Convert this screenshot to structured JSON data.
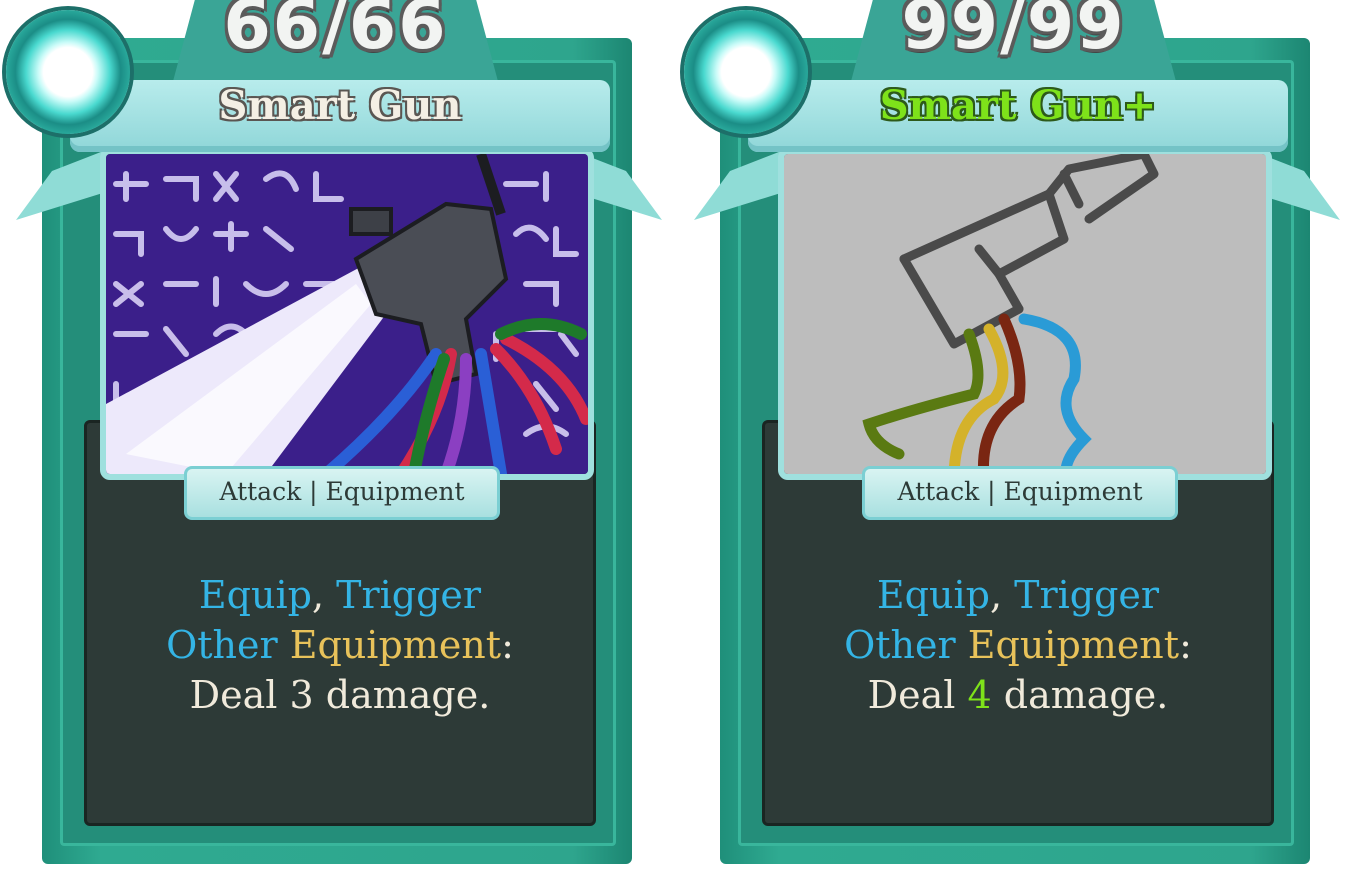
{
  "cards": [
    {
      "counter": "66/66",
      "title": "Smart Gun",
      "type_line": "Attack | Equipment",
      "desc": {
        "kw1": "Equip",
        "sep1": ", ",
        "kw2": "Trigger",
        "kw3": "Other",
        "sp": " ",
        "kw4": "Equipment",
        "colon": ":",
        "pre": "Deal ",
        "value": "3",
        "post": " damage."
      }
    },
    {
      "counter": "99/99",
      "title": "Smart Gun+",
      "type_line": "Attack | Equipment",
      "desc": {
        "kw1": "Equip",
        "sep1": ", ",
        "kw2": "Trigger",
        "kw3": "Other",
        "sp": " ",
        "kw4": "Equipment",
        "colon": ":",
        "pre": "Deal ",
        "value": "4",
        "post": " damage."
      }
    }
  ],
  "colors": {
    "frame": "#2ea58d",
    "panel": "#2d3a37",
    "keyword_blue": "#34b4e5",
    "keyword_gold": "#e8c25a",
    "upgrade_green": "#7ee21a"
  }
}
